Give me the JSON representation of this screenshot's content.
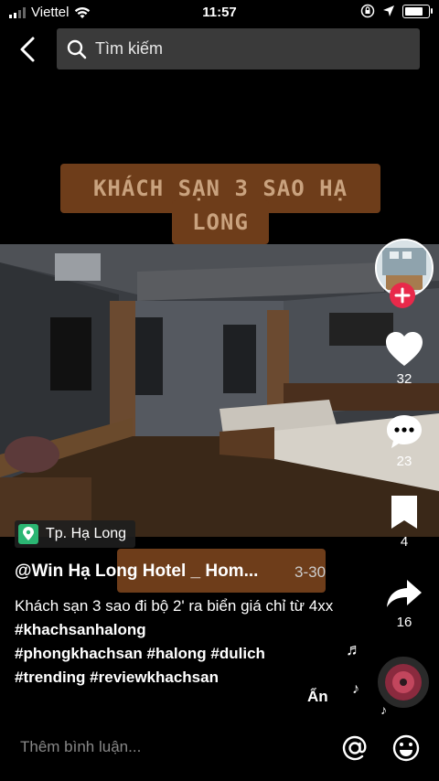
{
  "status_bar": {
    "carrier": "Viettel",
    "time": "11:57",
    "battery_level": 0.85
  },
  "header": {
    "search_placeholder": "Tìm kiếm"
  },
  "video": {
    "title_banner_line1": "KHÁCH SẠN 3 SAO HẠ",
    "title_banner_line2": "LONG"
  },
  "actions": {
    "likes": "32",
    "comments": "23",
    "saves": "4",
    "shares": "16"
  },
  "post": {
    "location": "Tp. Hạ Long",
    "username": "@Win Hạ Long Hotel _ Hom...",
    "date": "3-30",
    "caption_text": "Khách sạn 3 sao đi bộ 2' ra biển giá chỉ từ 4xx",
    "hashtags_line1": "#khachsanhalong",
    "hashtags_line2": "#phongkhachsan #halong #dulich",
    "hashtags_line3": "#trending #reviewkhachsan"
  },
  "hide_label": "Ẩn",
  "comment_placeholder": "Thêm bình luận...",
  "colors": {
    "like_red": "#e8294a",
    "location_green": "#2bb673",
    "banner_brown": "#6e3d1a"
  }
}
